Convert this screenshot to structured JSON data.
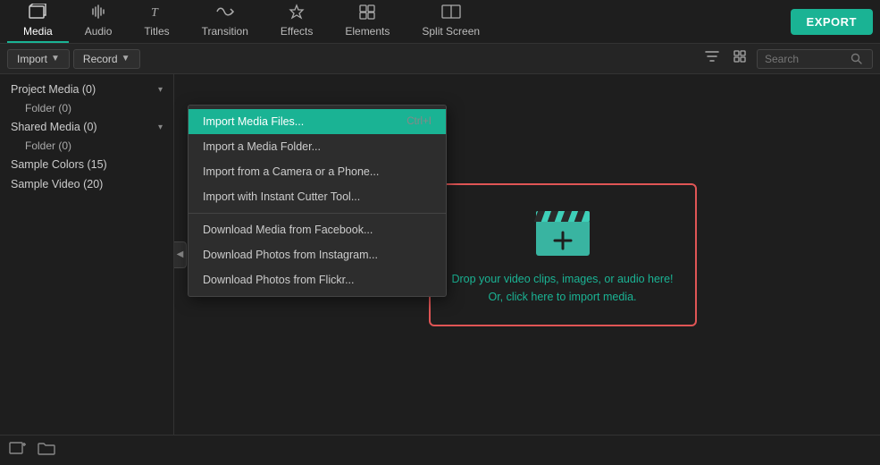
{
  "nav": {
    "items": [
      {
        "id": "media",
        "label": "Media",
        "icon": "🗂",
        "active": true
      },
      {
        "id": "audio",
        "label": "Audio",
        "icon": "♪"
      },
      {
        "id": "titles",
        "label": "Titles",
        "icon": "T"
      },
      {
        "id": "transition",
        "label": "Transition",
        "icon": "↔"
      },
      {
        "id": "effects",
        "label": "Effects",
        "icon": "✦"
      },
      {
        "id": "elements",
        "label": "Elements",
        "icon": "⊞"
      },
      {
        "id": "splitscreen",
        "label": "Split Screen",
        "icon": "▣"
      }
    ],
    "export_label": "EXPORT"
  },
  "toolbar": {
    "import_label": "Import",
    "record_label": "Record",
    "search_placeholder": "Search"
  },
  "sidebar": {
    "items": [
      {
        "id": "project-media",
        "label": "Project Media (0)",
        "has_chevron": true,
        "sub_items": [
          "Folder (0)"
        ]
      },
      {
        "id": "shared-media",
        "label": "Shared Media (0)",
        "has_chevron": true,
        "sub_items": [
          "Folder (0)"
        ]
      },
      {
        "id": "sample-colors",
        "label": "Sample Colors (15)",
        "has_chevron": false,
        "sub_items": []
      },
      {
        "id": "sample-video",
        "label": "Sample Video (20)",
        "has_chevron": false,
        "sub_items": []
      }
    ]
  },
  "dropdown": {
    "items": [
      {
        "id": "import-media-files",
        "label": "Import Media Files...",
        "shortcut": "Ctrl+I",
        "highlighted": true
      },
      {
        "id": "import-media-folder",
        "label": "Import a Media Folder...",
        "shortcut": ""
      },
      {
        "id": "import-camera",
        "label": "Import from a Camera or a Phone...",
        "shortcut": ""
      },
      {
        "id": "import-instant-cutter",
        "label": "Import with Instant Cutter Tool...",
        "shortcut": ""
      },
      {
        "id": "divider-1",
        "label": "__divider__"
      },
      {
        "id": "download-facebook",
        "label": "Download Media from Facebook...",
        "shortcut": ""
      },
      {
        "id": "download-instagram",
        "label": "Download Photos from Instagram...",
        "shortcut": ""
      },
      {
        "id": "download-flickr",
        "label": "Download Photos from Flickr...",
        "shortcut": ""
      }
    ]
  },
  "dropzone": {
    "line1": "Drop your video clips, images, or audio here!",
    "line2": "Or, click here to import media."
  },
  "bottom_bar": {
    "add_icon": "📁+",
    "folder_icon": "📁"
  },
  "colors": {
    "accent": "#1ab394",
    "danger": "#e05555",
    "bg_dark": "#1e1e1e",
    "bg_mid": "#252525",
    "text_primary": "#fff",
    "text_secondary": "#ccc"
  }
}
